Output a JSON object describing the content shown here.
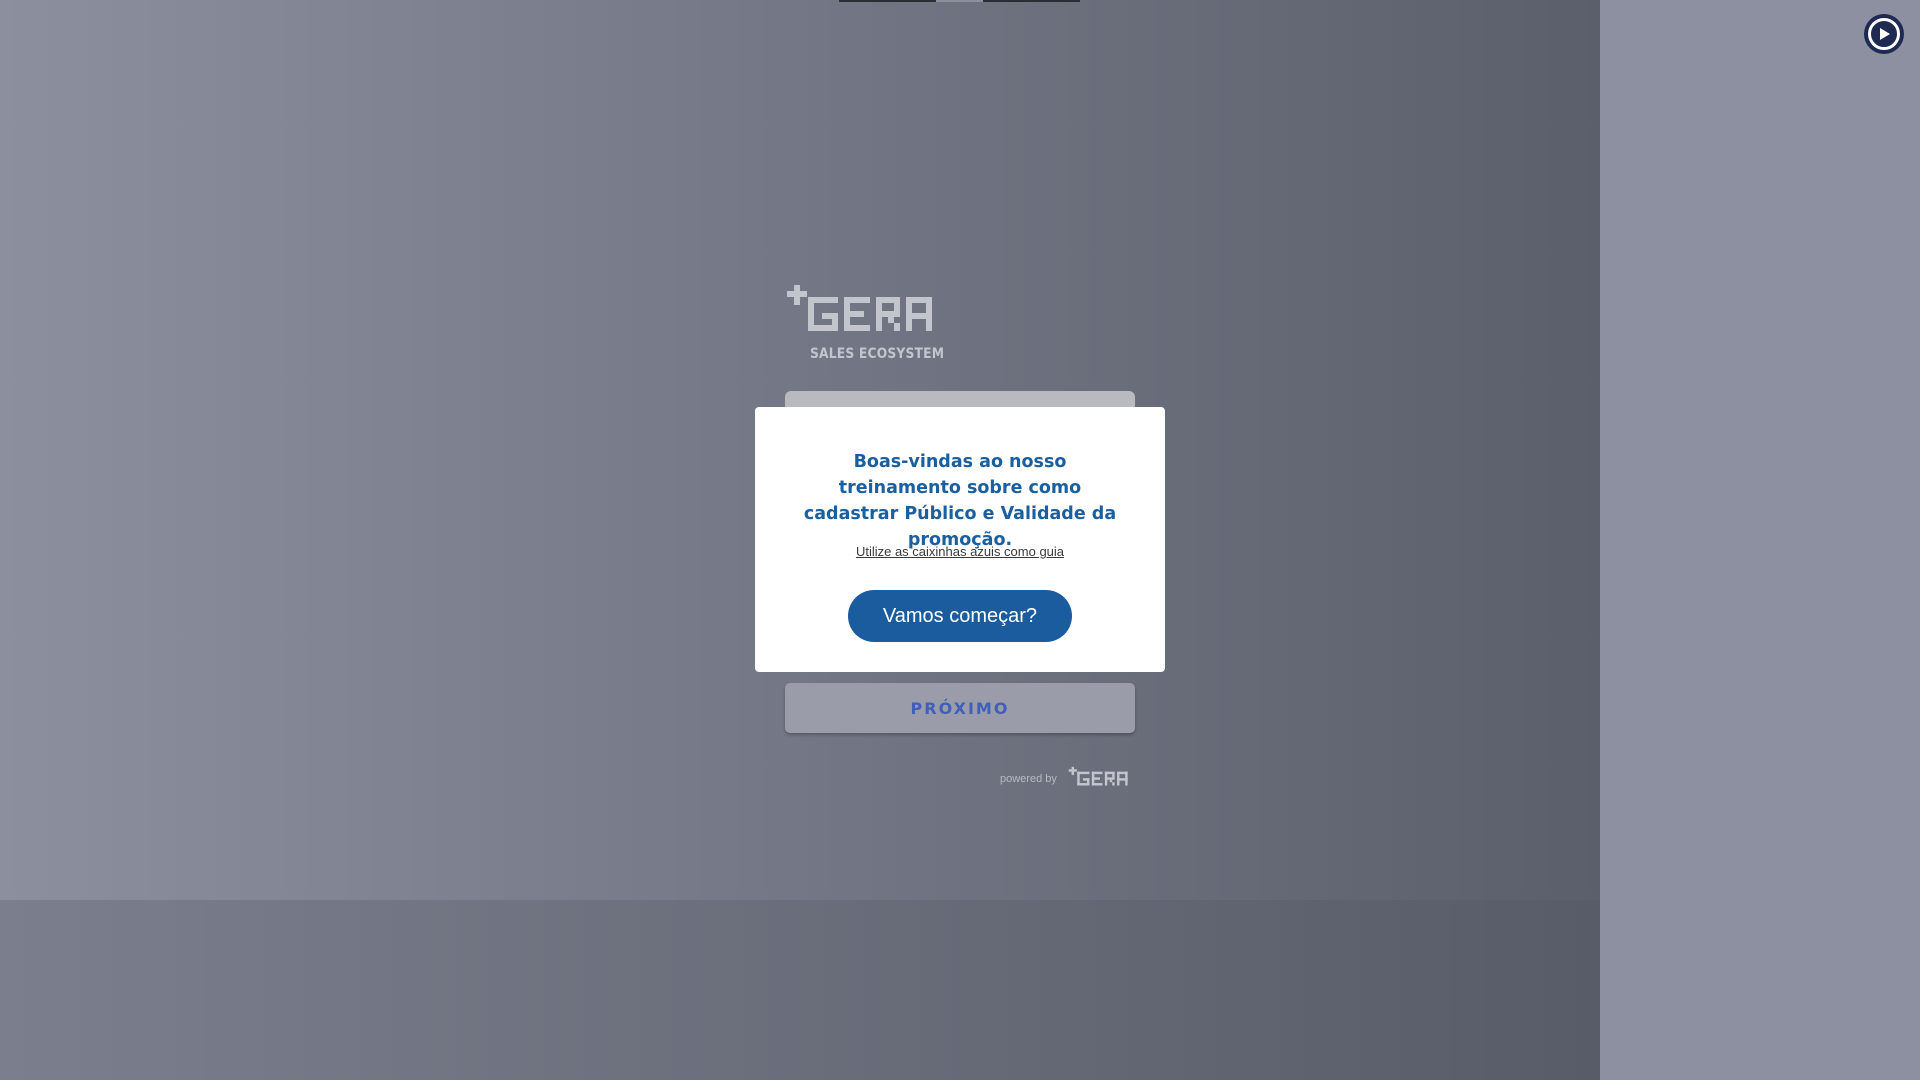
{
  "brand": {
    "logo_word": "GERA",
    "logo_subtitle": "SALES ECOSYSTEM",
    "powered_by": "powered by",
    "powered_logo_word": "GERA",
    "colors": {
      "accent_blue": "#1b5c9e",
      "title_blue": "#1a5fa0",
      "next_label": "#3f5fb8"
    }
  },
  "modal": {
    "title": "Boas-vindas ao nosso treinamento sobre como cadastrar Público e Validade da promoção.",
    "guide_link": "Utilize as caixinhas azuis como guia",
    "start_button": "Vamos começar?"
  },
  "form": {
    "next_button": "PRÓXIMO"
  },
  "icons": {
    "play": "play-circle-icon",
    "logo_plus": "plus-icon"
  }
}
